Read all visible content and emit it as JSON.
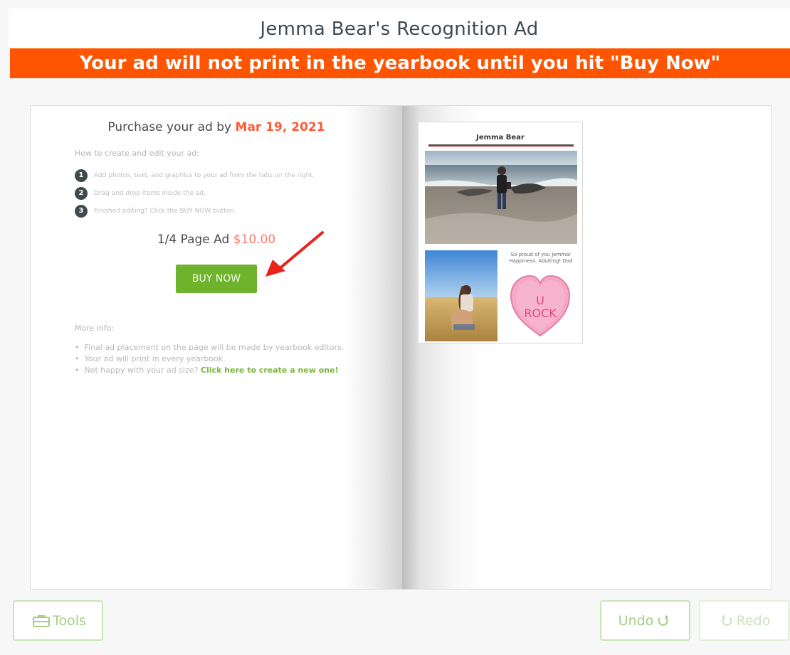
{
  "header": {
    "title": "Jemma Bear's Recognition Ad",
    "warning": "Your ad will not print in the yearbook until you hit \"Buy Now\""
  },
  "left_page": {
    "purchase_prefix": "Purchase your ad by ",
    "purchase_date": "Mar 19, 2021",
    "howto_heading": "How to create and edit your ad:",
    "steps": [
      {
        "num": "1",
        "text": "Add photos, text, and graphics to your ad from the tabs on the right."
      },
      {
        "num": "2",
        "text": "Drag and drop items inside the ad."
      },
      {
        "num": "3",
        "text": "Finished editing? Click the BUY NOW button."
      }
    ],
    "ad_size": "1/4 Page Ad ",
    "ad_price": "$10.00",
    "buy_label": "BUY NOW",
    "moreinfo_heading": "More info:",
    "info_items": [
      "Final ad placement on the page will be made by yearbook editors.",
      "Your ad will print in every yearbook."
    ],
    "info_last_prefix": "Not happy with your ad size? ",
    "info_last_link": "Click here to create a new one!"
  },
  "ad_preview": {
    "name": "Jemma Bear",
    "caption": "So proud of you Jemma! Happiness. Adulting! Dad",
    "heart_line1": "U",
    "heart_line2": "ROCK"
  },
  "toolbar": {
    "tools_label": "Tools",
    "undo_label": "Undo",
    "redo_label": "Redo"
  },
  "colors": {
    "warning_bg": "#ff5400",
    "buy_button": "#6fb22c",
    "date_accent": "#ff5a36",
    "button_border": "#c9e4b5"
  }
}
